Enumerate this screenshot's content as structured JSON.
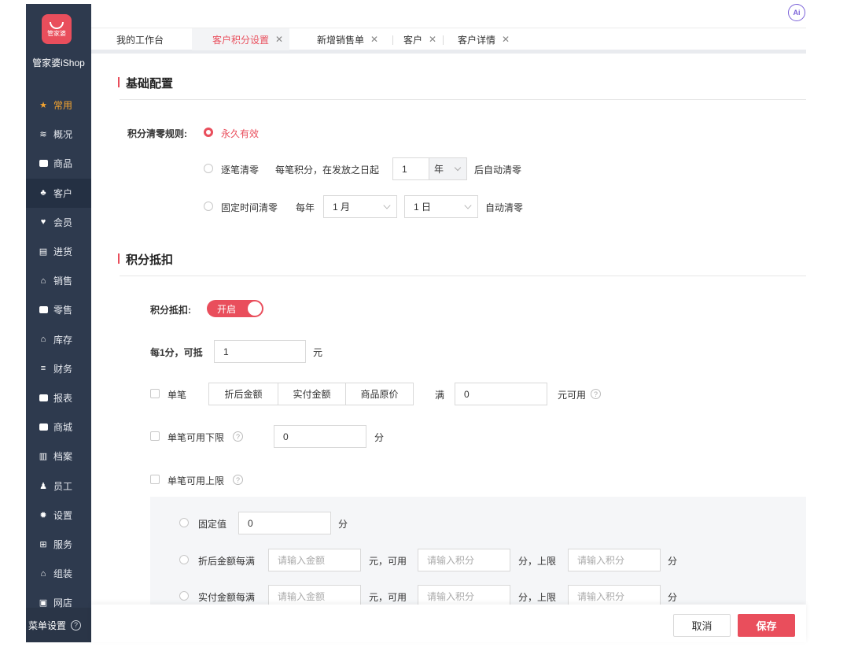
{
  "brand": {
    "logo_text": "管家婆",
    "name": "管家婆iShop",
    "accent": "#e94e5c"
  },
  "sidebar": {
    "items": [
      {
        "label": "常用",
        "icon": "star-icon"
      },
      {
        "label": "概况",
        "icon": "layers-icon"
      },
      {
        "label": "商品",
        "icon": "box-icon"
      },
      {
        "label": "客户",
        "icon": "customer-icon"
      },
      {
        "label": "会员",
        "icon": "heart-icon"
      },
      {
        "label": "进货",
        "icon": "cart-icon"
      },
      {
        "label": "销售",
        "icon": "basket-icon"
      },
      {
        "label": "零售",
        "icon": "register-icon"
      },
      {
        "label": "库存",
        "icon": "warehouse-icon"
      },
      {
        "label": "财务",
        "icon": "finance-icon"
      },
      {
        "label": "报表",
        "icon": "report-icon"
      },
      {
        "label": "商城",
        "icon": "mall-icon"
      },
      {
        "label": "档案",
        "icon": "archive-icon"
      },
      {
        "label": "员工",
        "icon": "staff-icon"
      },
      {
        "label": "设置",
        "icon": "gear-icon"
      },
      {
        "label": "服务",
        "icon": "grid-icon"
      },
      {
        "label": "组装",
        "icon": "assemble-icon"
      },
      {
        "label": "网店",
        "icon": "shop-icon"
      }
    ],
    "menu_settings": "菜单设置"
  },
  "ai_label": "Ai",
  "tabs": [
    {
      "label": "我的工作台",
      "closable": false
    },
    {
      "label": "客户积分设置",
      "closable": true
    },
    {
      "label": "新增销售单",
      "closable": true
    },
    {
      "label": "客户",
      "closable": true
    },
    {
      "label": "客户详情",
      "closable": true
    }
  ],
  "basic": {
    "title": "基础配置",
    "clear_rule_label": "积分清零规则:",
    "opt_forever": "永久有效",
    "opt_each": "逐笔清零",
    "each_desc": "每笔积分，在发放之日起",
    "each_value": "1",
    "each_unit": "年",
    "each_suffix": "后自动清零",
    "opt_fixed": "固定时间清零",
    "fixed_prefix": "每年",
    "fixed_month": "1 月",
    "fixed_day": "1 日",
    "fixed_suffix": "自动清零"
  },
  "deduct": {
    "title": "积分抵扣",
    "toggle_label": "积分抵扣:",
    "toggle_state": "开启",
    "rate_label": "每1分，可抵",
    "rate_value": "1",
    "rate_unit": "元",
    "single_label": "单笔",
    "seg_options": [
      "折后金额",
      "实付金额",
      "商品原价"
    ],
    "full_label": "满",
    "full_value": "0",
    "full_suffix": "元可用",
    "min_label": "单笔可用下限",
    "min_value": "0",
    "min_unit": "分",
    "max_label": "单笔可用上限",
    "fixed_label": "固定值",
    "fixed_value": "0",
    "fixed_unit": "分",
    "after_label": "折后金额每满",
    "paid_label": "实付金额每满",
    "amount_ph": "请输入金额",
    "mid_text": "元，可用",
    "points_ph": "请输入积分",
    "cap_text": "分，上限",
    "end_unit": "分"
  },
  "footer": {
    "cancel": "取消",
    "save": "保存"
  }
}
